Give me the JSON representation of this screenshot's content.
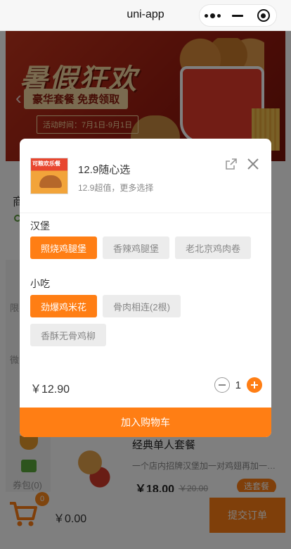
{
  "nav": {
    "title": "uni-app"
  },
  "banner": {
    "title": "暑假狂欢",
    "subtitle": "豪华套餐 免费领取",
    "date": "活动时间：7月1日-9月1日"
  },
  "page": {
    "heading": "商",
    "left_items": [
      "限",
      "微"
    ],
    "coupon_label": "券包(0)",
    "product": {
      "name": "经典单人套餐",
      "desc": "一个店内招牌汉堡加一对鸡翅再加一…",
      "price": "￥18.00",
      "original_price": "￥20.00",
      "button": "选套餐"
    }
  },
  "cart": {
    "badge": "0",
    "total": "￥0.00",
    "submit": "提交订单"
  },
  "modal": {
    "thumb_text": "可粮欢乐餐",
    "name": "12.9随心选",
    "desc": "12.9超值，更多选择",
    "groups": [
      {
        "label": "汉堡",
        "options": [
          "照烧鸡腿堡",
          "香辣鸡腿堡",
          "老北京鸡肉卷"
        ],
        "selected": 0
      },
      {
        "label": "小吃",
        "options": [
          "劲爆鸡米花",
          "骨肉相连(2根)",
          "香酥无骨鸡柳"
        ],
        "selected": 0
      }
    ],
    "price": "￥12.90",
    "quantity": "1",
    "add_button": "加入购物车"
  },
  "colors": {
    "accent": "#ff7e14"
  },
  "icons": [
    "more-icon",
    "minimize-icon",
    "close-app-icon",
    "cart-icon",
    "share-icon",
    "close-icon",
    "minus-icon",
    "plus-icon",
    "location-icon"
  ]
}
